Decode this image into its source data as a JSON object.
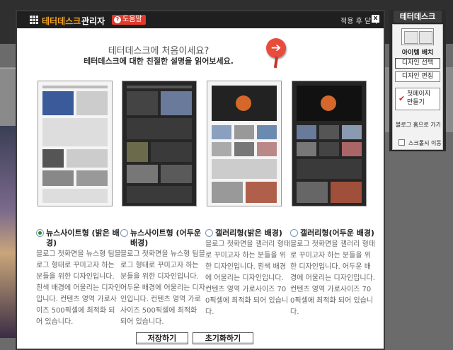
{
  "modal": {
    "brand": "테터데스크",
    "brand_sub": "관리자",
    "help": "도움말",
    "apply_close": "적용 후 닫기",
    "close": "x"
  },
  "intro": {
    "title": "테터데스크에 처음이세요?",
    "subtitle": "테터데스크에 대한 친절한 설명을 읽어보세요."
  },
  "options": [
    {
      "label": "뉴스사이트형 (밝은 배경)",
      "selected": true,
      "desc": "블로그 첫화면을 뉴스형 팀블로그 형태로 꾸미고자 하는 분들을 위한 디자인입니다. 흰색 배경에 어울리는 디자인입니다. 컨텐츠 영역 가로사이즈 500픽셀에 최적화 되어 있습니다."
    },
    {
      "label": "뉴스사이트형 (어두운 배경)",
      "selected": false,
      "desc": "블로그 첫화면을 뉴스형 팀블로그 형태로 꾸미고자 하는 분들을 위한 디자인입니다. 어두운 배경에 어울리는 디자인입니다. 컨텐츠 영역 가로사이즈 500픽셀에 최적화 되어 있습니다."
    },
    {
      "label": "갤러리형(밝은 배경)",
      "selected": false,
      "desc": "블로그 첫화면을 갤러리 형태로 꾸미고자 하는 분들을 위한 디자인입니다. 흰색 배경에 어울리는 디자인입니다. 컨텐츠 영역 가로사이즈 700픽셀에 최적화 되어 있습니다."
    },
    {
      "label": "갤러리형(어두운 배경)",
      "selected": false,
      "desc": "블로그 첫화면을 갤러리 형태로 꾸미고자 하는 분들을 위한 디자인입니다. 어두운 배경에 어울리는 디자인입니다. 컨텐츠 영역 가로사이즈 700픽셀에 최적화 되어 있습니다."
    }
  ],
  "buttons": {
    "save": "저장하기",
    "reset": "초기화하기"
  },
  "panel": {
    "title": "테터데스크",
    "layout": "아이템 배치",
    "design_select": "디자인 선택",
    "design_edit": "디자인 편집",
    "first_page": "첫페이지 만들기",
    "blog_home": "블로그 홈으로 가기",
    "scroll_move": "스크롤시 이동"
  }
}
